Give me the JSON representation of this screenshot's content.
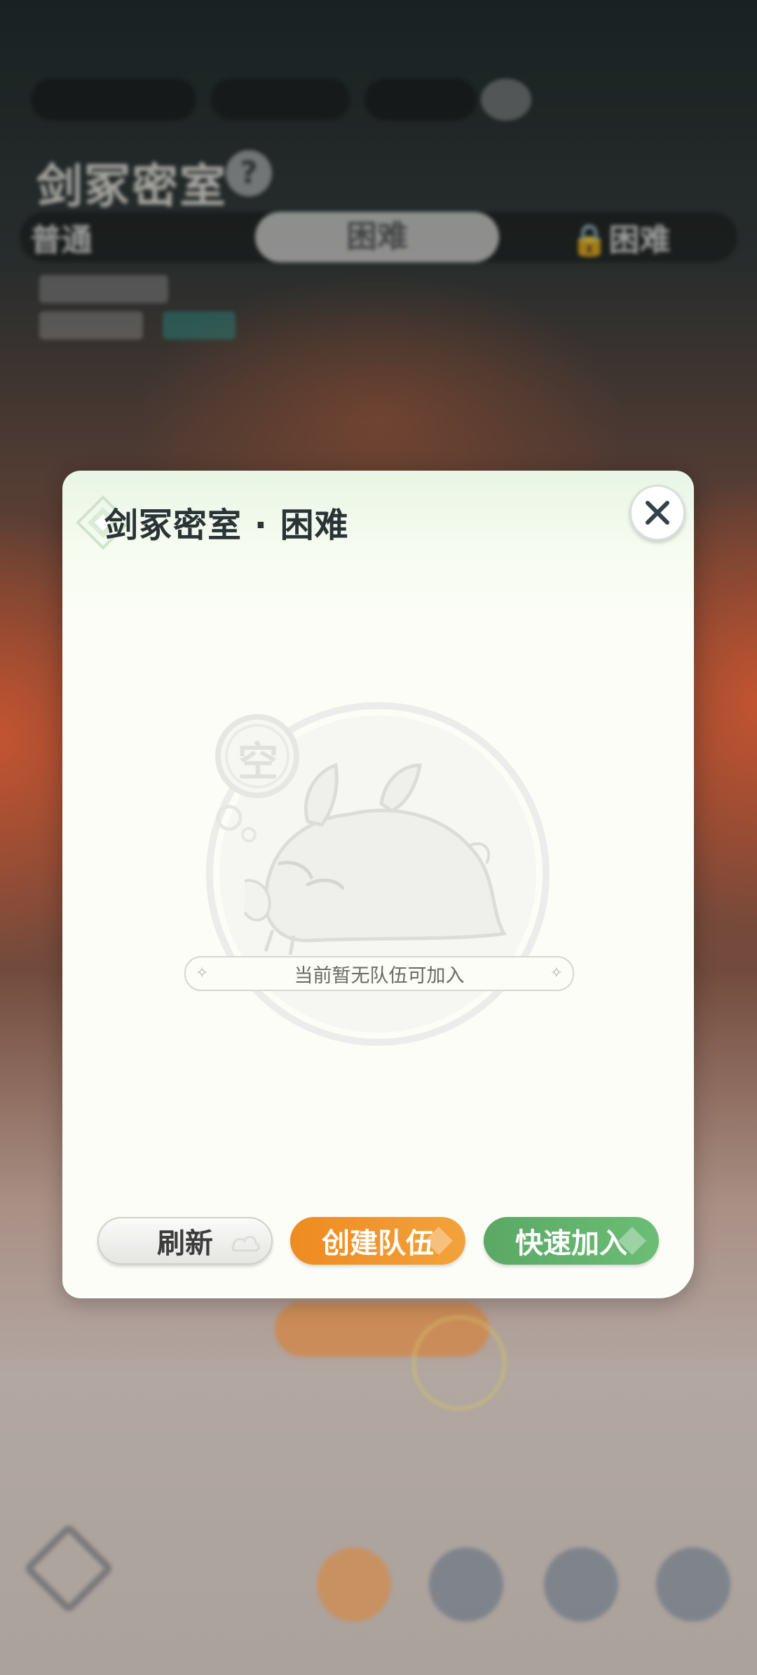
{
  "dialog": {
    "title": "剑冢密室 · 困难",
    "empty_glyph": "空",
    "empty_message": "当前暂无队伍可加入",
    "buttons": {
      "refresh": "刷新",
      "create_team": "创建队伍",
      "quick_join": "快速加入"
    },
    "close_icon": "close-icon"
  },
  "background": {
    "page_title": "剑冢密室",
    "difficulty_tabs": [
      "普通",
      "困难",
      "🔒困难"
    ],
    "active_tab": "困难"
  },
  "colors": {
    "dialog_bg": "#fcfdf7",
    "title_text": "#2a3437",
    "refresh_btn": "#eeeeeb",
    "create_btn": "#f09a30",
    "quick_btn": "#62b26d"
  }
}
